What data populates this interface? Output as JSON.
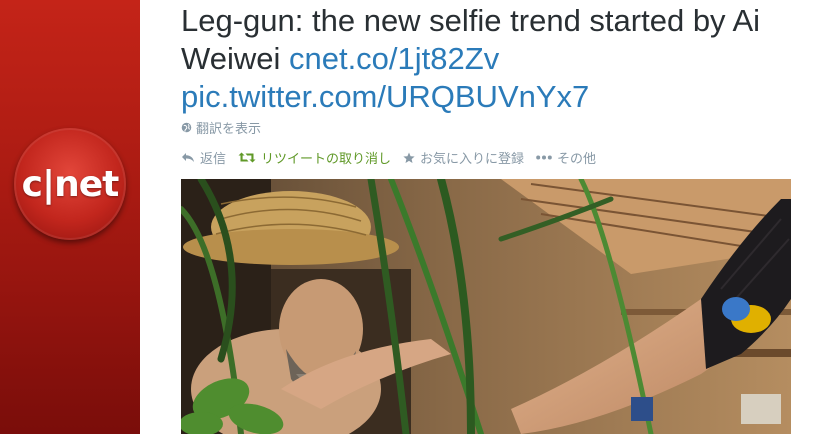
{
  "profile": {
    "logo_text": "c|net",
    "icon": "cnet-logo"
  },
  "tweet": {
    "text_main": "Leg-gun: the new selfie trend started by Ai Weiwei ",
    "link_1": "cnet.co/1jt82Zv",
    "link_2": "pic.twitter.com/URQBUVnYx7"
  },
  "translate": {
    "label": "翻訳を表示",
    "icon": "globe-icon"
  },
  "actions": {
    "reply": {
      "label": "返信",
      "icon": "reply-icon"
    },
    "retweet": {
      "label": "リツイートの取り消し",
      "icon": "retweet-icon",
      "color": "#609928"
    },
    "favorite": {
      "label": "お気に入りに登録",
      "icon": "star-icon"
    },
    "more": {
      "label": "その他",
      "icon": "ellipsis-icon"
    }
  },
  "colors": {
    "link": "#2b7bb9",
    "text": "#292f33",
    "muted": "#8899a6",
    "brand_red": "#c42418"
  }
}
